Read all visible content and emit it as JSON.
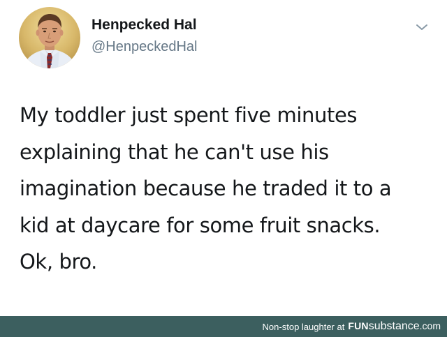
{
  "tweet": {
    "author": {
      "display_name": "Henpecked Hal",
      "handle": "@HenpeckedHal",
      "avatar_icon": "profile-photo"
    },
    "menu_icon": "chevron-down-icon",
    "text_lines": [
      "My toddler just spent five minutes",
      "explaining that he can't use his",
      "imagination because he traded it to a",
      "kid at daycare for some fruit snacks.",
      "Ok, bro."
    ]
  },
  "footer": {
    "text": "Non-stop laughter at",
    "logo_part1": "FUN",
    "logo_part2": "substance",
    "logo_part3": ".com",
    "background_color": "#3c5f5f"
  }
}
